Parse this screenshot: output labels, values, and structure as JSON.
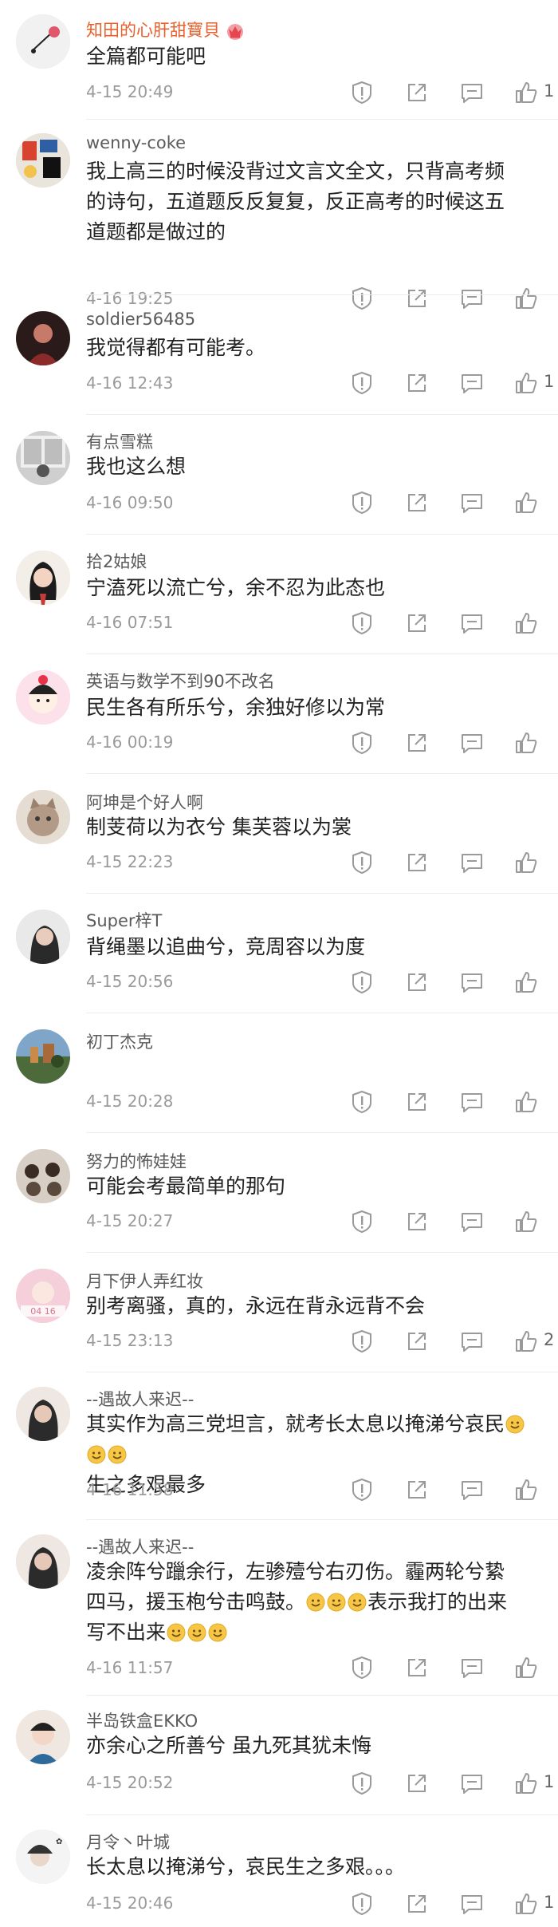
{
  "comments": [
    {
      "username": "知田的心肝甜寶貝",
      "vip": true,
      "lines": [
        "全篇都可能吧"
      ],
      "time": "4-15 20:49",
      "likes": "1"
    },
    {
      "username": "wenny-coke",
      "vip": false,
      "lines": [
        "我上高三的时候没背过文言文全文，只背高考频",
        "的诗句，五道题反反复复，反正高考的时候这五",
        "道题都是做过的"
      ],
      "time": "4-16 19:25",
      "likes": ""
    },
    {
      "username": "soldier56485",
      "vip": false,
      "lines": [
        "我觉得都有可能考。"
      ],
      "time": "4-16 12:43",
      "likes": "1"
    },
    {
      "username": "有点雪糕",
      "vip": false,
      "lines": [
        "我也这么想"
      ],
      "time": "4-16 09:50",
      "likes": ""
    },
    {
      "username": "拾2姑娘",
      "vip": false,
      "lines": [
        "宁溘死以流亡兮，余不忍为此态也"
      ],
      "time": "4-16 07:51",
      "likes": ""
    },
    {
      "username": "英语与数学不到90不改名",
      "vip": false,
      "lines": [
        "民生各有所乐兮，余独好修以为常"
      ],
      "time": "4-16 00:19",
      "likes": ""
    },
    {
      "username": "阿坤是个好人啊",
      "vip": false,
      "lines": [
        "制芰荷以为衣兮 集芙蓉以为裳"
      ],
      "time": "4-15 22:23",
      "likes": ""
    },
    {
      "username": "Super梓T",
      "vip": false,
      "lines": [
        "背绳墨以追曲兮，竞周容以为度"
      ],
      "time": "4-15 20:56",
      "likes": ""
    },
    {
      "username": "初丁杰克",
      "vip": false,
      "lines": [
        ""
      ],
      "emojis": [
        1
      ],
      "time": "4-15 20:28",
      "likes": ""
    },
    {
      "username": "努力的怖娃娃",
      "vip": false,
      "lines": [
        "可能会考最简单的那句"
      ],
      "emojis": [
        1
      ],
      "time": "4-15 20:27",
      "likes": ""
    },
    {
      "username": "月下伊人弄红妆",
      "vip": false,
      "lines": [
        "别考离骚，真的，永远在背永远背不会"
      ],
      "time": "4-15 23:13",
      "likes": "2"
    },
    {
      "username": "--遇故人来迟--",
      "vip": false,
      "lines": [
        "其实作为高三党坦言，就考长太息以掩涕兮哀民",
        "生之多艰最多"
      ],
      "emojis": [
        0,
        3
      ],
      "time": "4-16 11:58",
      "likes": ""
    },
    {
      "username": "--遇故人来迟--",
      "vip": false,
      "lines": [
        "凌余阵兮躐余行，左骖殪兮右刃伤。霾两轮兮絷",
        "四马，援玉枹兮击鸣鼓。",
        "写不出来"
      ],
      "emojis_lines": {
        "1": {
          "count": 3,
          "after": "表示我打的出来"
        },
        "2": {
          "count": 3
        }
      },
      "time": "4-16 11:57",
      "likes": ""
    },
    {
      "username": "半岛铁盒EKKO",
      "vip": false,
      "lines": [
        "亦余心之所善兮 虽九死其犹未悔"
      ],
      "time": "4-15 20:52",
      "likes": "1"
    },
    {
      "username": "月令丶叶城",
      "vip": false,
      "lines": [
        "长太息以掩涕兮，哀民生之多艰。。。"
      ],
      "time": "4-15 20:46",
      "likes": "1"
    }
  ],
  "icons": {
    "report": "report-icon",
    "share": "share-icon",
    "reply": "reply-icon",
    "like": "like-icon",
    "crown": "crown-badge-icon",
    "emoji": "smile-emoji-icon"
  },
  "colors": {
    "vip_name": "#e8612c",
    "name": "#5b5b5b",
    "text": "#222222",
    "time": "#9a9a9a",
    "icon": "#9a9a9a",
    "divider": "#ececec"
  }
}
